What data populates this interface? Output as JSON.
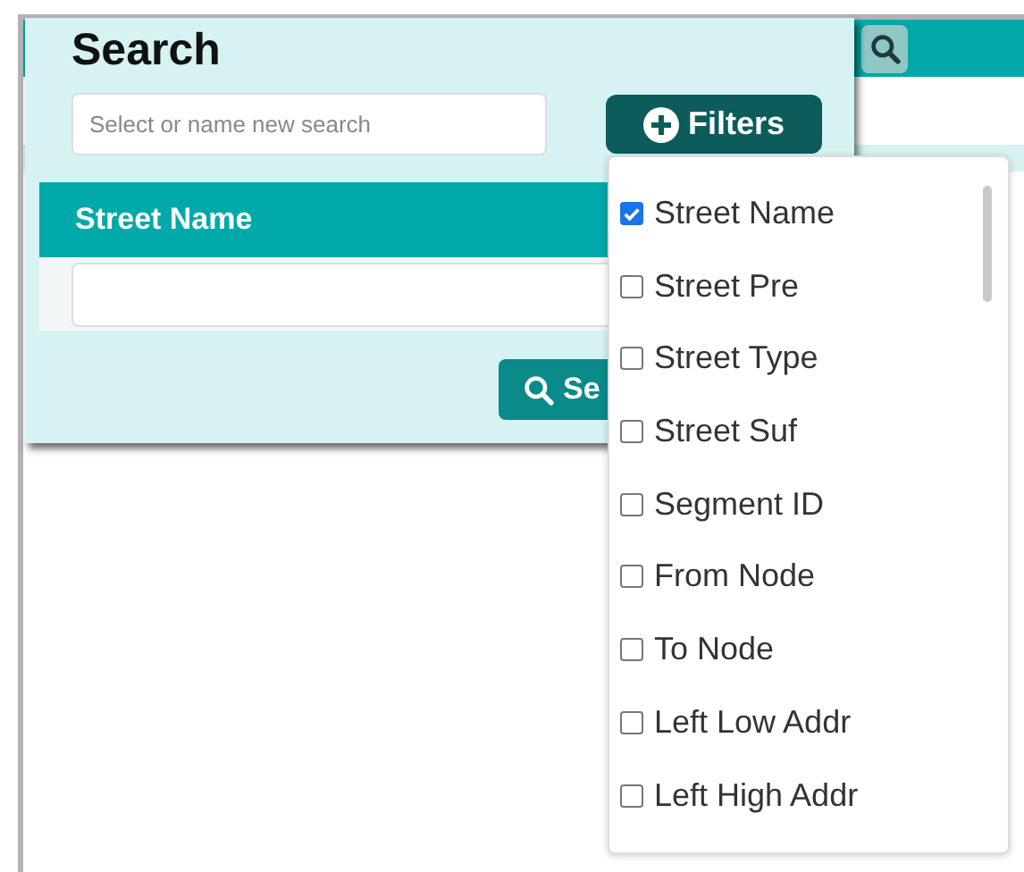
{
  "panel": {
    "title": "Search",
    "name_field": {
      "placeholder": "Select or name new search"
    },
    "filters_button": {
      "label": "Filters"
    },
    "field_header": "Street Name",
    "search_button": {
      "label": "Se"
    }
  },
  "filter_options": [
    {
      "label": "Street Name",
      "checked": true
    },
    {
      "label": "Street Pre",
      "checked": false
    },
    {
      "label": "Street Type",
      "checked": false
    },
    {
      "label": "Street Suf",
      "checked": false
    },
    {
      "label": "Segment ID",
      "checked": false
    },
    {
      "label": "From Node",
      "checked": false
    },
    {
      "label": "To Node",
      "checked": false
    },
    {
      "label": "Left Low Addr",
      "checked": false
    },
    {
      "label": "Left High Addr",
      "checked": false
    }
  ]
}
